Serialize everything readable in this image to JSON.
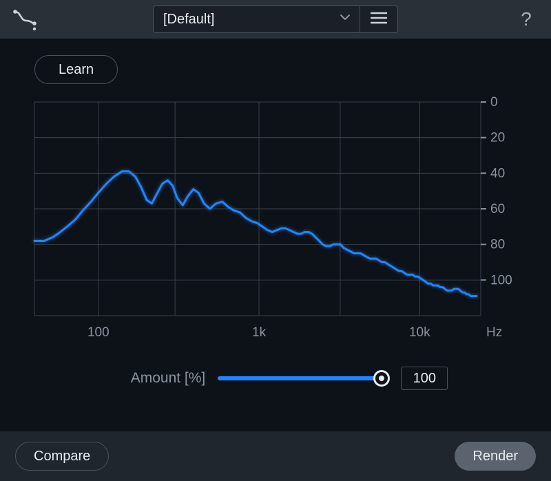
{
  "header": {
    "preset_name": "[Default]"
  },
  "controls": {
    "learn_label": "Learn",
    "amount_label": "Amount [%]",
    "amount_value": "100"
  },
  "footer": {
    "compare_label": "Compare",
    "render_label": "Render"
  },
  "colors": {
    "accent": "#1f86ff",
    "grid": "#3a424c",
    "bg": "#0d1218"
  },
  "chart_data": {
    "type": "line",
    "title": "",
    "xlabel": "Hz",
    "ylabel": "",
    "x_scale": "log",
    "xlim": [
      40,
      24000
    ],
    "ylim": [
      -120,
      0
    ],
    "x_ticks": [
      100,
      1000,
      10000
    ],
    "x_tick_labels": [
      "100",
      "1k",
      "10k"
    ],
    "y_ticks": [
      0,
      -20,
      -40,
      -60,
      -80,
      -100
    ],
    "y_tick_labels": [
      "0",
      "20",
      "40",
      "60",
      "80",
      "100"
    ],
    "x_unit_label": "Hz",
    "series": [
      {
        "name": "spectrum",
        "color": "#1f86ff",
        "points": [
          [
            40,
            -78
          ],
          [
            46,
            -78
          ],
          [
            52,
            -76
          ],
          [
            58,
            -73
          ],
          [
            64,
            -70
          ],
          [
            72,
            -66
          ],
          [
            80,
            -61
          ],
          [
            90,
            -56
          ],
          [
            100,
            -51
          ],
          [
            112,
            -46
          ],
          [
            125,
            -42
          ],
          [
            140,
            -39
          ],
          [
            155,
            -39
          ],
          [
            170,
            -42
          ],
          [
            185,
            -48
          ],
          [
            200,
            -55
          ],
          [
            215,
            -57
          ],
          [
            230,
            -52
          ],
          [
            250,
            -46
          ],
          [
            270,
            -44
          ],
          [
            290,
            -47
          ],
          [
            310,
            -54
          ],
          [
            335,
            -58
          ],
          [
            360,
            -53
          ],
          [
            390,
            -49
          ],
          [
            420,
            -51
          ],
          [
            455,
            -57
          ],
          [
            495,
            -60
          ],
          [
            540,
            -57
          ],
          [
            590,
            -56
          ],
          [
            645,
            -59
          ],
          [
            700,
            -61
          ],
          [
            760,
            -62
          ],
          [
            825,
            -65
          ],
          [
            900,
            -67
          ],
          [
            975,
            -68
          ],
          [
            1050,
            -70
          ],
          [
            1130,
            -72
          ],
          [
            1210,
            -73
          ],
          [
            1290,
            -72
          ],
          [
            1375,
            -71
          ],
          [
            1460,
            -71
          ],
          [
            1550,
            -72
          ],
          [
            1640,
            -73
          ],
          [
            1735,
            -74
          ],
          [
            1830,
            -74
          ],
          [
            1930,
            -73
          ],
          [
            2030,
            -73
          ],
          [
            2140,
            -74
          ],
          [
            2250,
            -76
          ],
          [
            2370,
            -78
          ],
          [
            2490,
            -80
          ],
          [
            2620,
            -81
          ],
          [
            2760,
            -81
          ],
          [
            2900,
            -80
          ],
          [
            3050,
            -80
          ],
          [
            3210,
            -80
          ],
          [
            3370,
            -82
          ],
          [
            3540,
            -83
          ],
          [
            3720,
            -84
          ],
          [
            3900,
            -85
          ],
          [
            4090,
            -85
          ],
          [
            4280,
            -85
          ],
          [
            4480,
            -86
          ],
          [
            4690,
            -87
          ],
          [
            4900,
            -88
          ],
          [
            5120,
            -88
          ],
          [
            5350,
            -88
          ],
          [
            5580,
            -89
          ],
          [
            5820,
            -90
          ],
          [
            6070,
            -90
          ],
          [
            6320,
            -91
          ],
          [
            6590,
            -92
          ],
          [
            6860,
            -93
          ],
          [
            7140,
            -94
          ],
          [
            7430,
            -95
          ],
          [
            7730,
            -95
          ],
          [
            8040,
            -96
          ],
          [
            8360,
            -97
          ],
          [
            8690,
            -97
          ],
          [
            9030,
            -97
          ],
          [
            9380,
            -98
          ],
          [
            9740,
            -98
          ],
          [
            10110,
            -99
          ],
          [
            10490,
            -100
          ],
          [
            10880,
            -101
          ],
          [
            11280,
            -102
          ],
          [
            11690,
            -102
          ],
          [
            12110,
            -103
          ],
          [
            12540,
            -103
          ],
          [
            12980,
            -103
          ],
          [
            13430,
            -104
          ],
          [
            13890,
            -104
          ],
          [
            14360,
            -105
          ],
          [
            14840,
            -106
          ],
          [
            15330,
            -106
          ],
          [
            15830,
            -106
          ],
          [
            16340,
            -105
          ],
          [
            16860,
            -105
          ],
          [
            17390,
            -105
          ],
          [
            17930,
            -106
          ],
          [
            18480,
            -107
          ],
          [
            19040,
            -107
          ],
          [
            19610,
            -108
          ],
          [
            20190,
            -108
          ],
          [
            20780,
            -109
          ],
          [
            21380,
            -109
          ],
          [
            21990,
            -109
          ],
          [
            22610,
            -109
          ]
        ]
      }
    ]
  }
}
